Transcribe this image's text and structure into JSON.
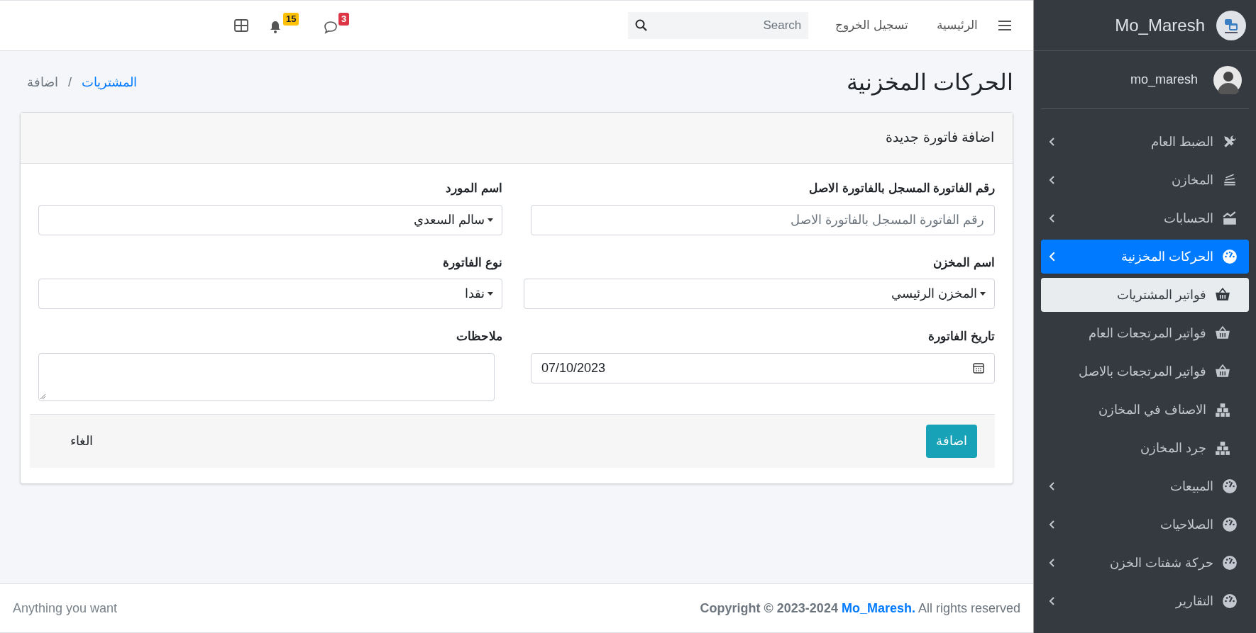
{
  "navbar": {
    "links": [
      "الرئيسية",
      "تسجيل الخروج"
    ],
    "search": {
      "placeholder": "Search"
    },
    "notifications": [
      {
        "kind": "messages",
        "badge": "3",
        "color": "#dc3545"
      },
      {
        "kind": "bell",
        "badge": "15",
        "color": "#ffc107"
      }
    ]
  },
  "page": {
    "title": "الحركات المخزنية",
    "separator": "/",
    "breadcrumb": [
      {
        "label": "المشتريات",
        "link": true
      },
      {
        "label": "اضافة",
        "link": false
      }
    ]
  },
  "card": {
    "title": "اضافة فاتورة جديدة",
    "fields": [
      {
        "kind": "text",
        "label": "رقم الفاتورة المسجل بالفاتورة الاصل",
        "placeholder": "رقم الفاتورة المسجل بالفاتورة الاصل"
      },
      {
        "kind": "select",
        "label": "اسم المورد",
        "value": "سالم السعدي"
      },
      {
        "kind": "select",
        "label": "اسم المخزن",
        "value": "المخزن الرئيسي"
      },
      {
        "kind": "select",
        "label": "نوع الفاتورة",
        "value": "نقدا"
      },
      {
        "kind": "date",
        "label": "تاريخ الفاتورة",
        "value": "07/10/2023"
      },
      {
        "kind": "textarea",
        "label": "ملاحظات"
      }
    ],
    "submit": "اضافة",
    "cancel": "الغاء"
  },
  "footer": {
    "left": "Anything you want",
    "copyright": "Copyright © 2023-2024",
    "author": "Mo_Maresh.",
    "rights": "All rights reserved"
  },
  "sidebar": {
    "brand": "Mo_Maresh",
    "user": "mo_maresh",
    "items": [
      {
        "label": "الضبط العام",
        "kind": "tools",
        "selected": false,
        "expanded": false
      },
      {
        "label": "المخازن",
        "kind": "layers",
        "selected": false,
        "expanded": false
      },
      {
        "label": "الحسابات",
        "kind": "chart",
        "selected": false,
        "expanded": false
      },
      {
        "label": "الحركات المخزنية",
        "kind": "gauge",
        "selected": true,
        "expanded": true,
        "children": [
          {
            "label": "فواتير المشتريات",
            "kind": "basket",
            "selected": true
          },
          {
            "label": "فواتير المرتجعات العام",
            "kind": "basket",
            "selected": false
          },
          {
            "label": "فواتير المرتجعات بالاصل",
            "kind": "basket",
            "selected": false
          },
          {
            "label": "الاصناف في المخازن",
            "kind": "cubes",
            "selected": false
          },
          {
            "label": "جرد المخازن",
            "kind": "cubes",
            "selected": false
          }
        ]
      },
      {
        "label": "المبيعات",
        "kind": "gauge",
        "selected": false,
        "expanded": false
      },
      {
        "label": "الصلاحيات",
        "kind": "gauge",
        "selected": false,
        "expanded": false
      },
      {
        "label": "حركة شفتات الخزن",
        "kind": "gauge",
        "selected": false,
        "expanded": false
      },
      {
        "label": "التقارير",
        "kind": "gauge",
        "selected": false,
        "expanded": false
      }
    ]
  }
}
